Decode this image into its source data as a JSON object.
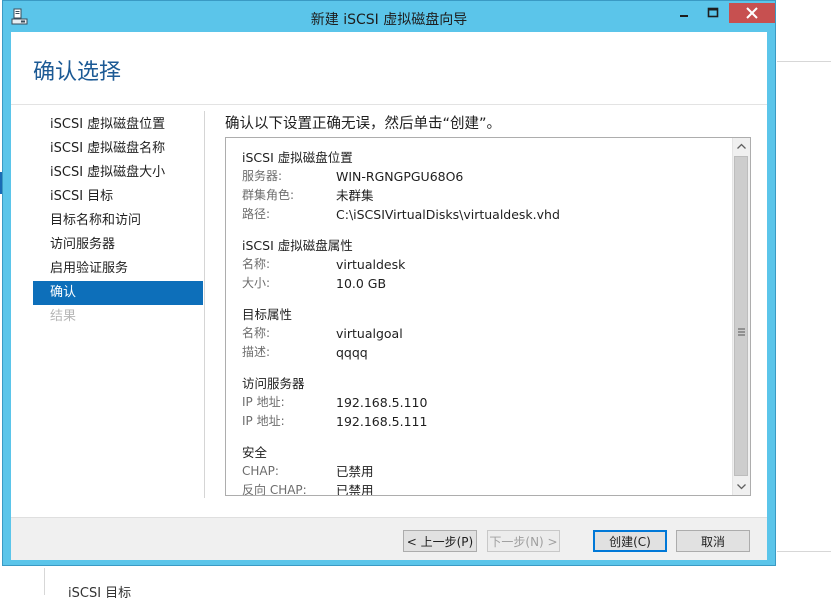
{
  "window": {
    "title": "新建 iSCSI 虚拟磁盘向导"
  },
  "page": {
    "heading": "确认选择",
    "main_title": "确认以下设置正确无误，然后单击“创建”。"
  },
  "nav": {
    "items": [
      {
        "label": "iSCSI 虚拟磁盘位置",
        "state": "normal"
      },
      {
        "label": "iSCSI 虚拟磁盘名称",
        "state": "normal"
      },
      {
        "label": "iSCSI 虚拟磁盘大小",
        "state": "normal"
      },
      {
        "label": "iSCSI 目标",
        "state": "normal"
      },
      {
        "label": "目标名称和访问",
        "state": "normal"
      },
      {
        "label": "访问服务器",
        "state": "normal"
      },
      {
        "label": "启用验证服务",
        "state": "normal"
      },
      {
        "label": "确认",
        "state": "active"
      },
      {
        "label": "结果",
        "state": "disabled"
      }
    ]
  },
  "summary": {
    "sections": [
      {
        "title": "iSCSI 虚拟磁盘位置",
        "rows": [
          {
            "label": "服务器:",
            "value": "WIN-RGNGPGU68O6"
          },
          {
            "label": "群集角色:",
            "value": "未群集"
          },
          {
            "label": "路径:",
            "value": "C:\\iSCSIVirtualDisks\\virtualdesk.vhd"
          }
        ]
      },
      {
        "title": "iSCSI 虚拟磁盘属性",
        "rows": [
          {
            "label": "名称:",
            "value": "virtualdesk"
          },
          {
            "label": "大小:",
            "value": "10.0 GB"
          }
        ]
      },
      {
        "title": "目标属性",
        "rows": [
          {
            "label": "名称:",
            "value": "virtualgoal"
          },
          {
            "label": "描述:",
            "value": "qqqq"
          }
        ]
      },
      {
        "title": "访问服务器",
        "rows": [
          {
            "label": "IP 地址:",
            "value": "192.168.5.110"
          },
          {
            "label": "IP 地址:",
            "value": "192.168.5.111"
          }
        ]
      },
      {
        "title": "安全",
        "rows": [
          {
            "label": "CHAP:",
            "value": "已禁用"
          },
          {
            "label": "反向 CHAP:",
            "value": "已禁用"
          }
        ]
      }
    ]
  },
  "footer": {
    "prev_label": "< 上一步(P)",
    "next_label": "下一步(N) >",
    "create_label": "创建(C)",
    "cancel_label": "取消"
  },
  "background": {
    "bottom_text": "iSCSI 目标"
  },
  "colors": {
    "titlebar": "#5bc5ea",
    "heading": "#1c5a95",
    "nav_active": "#0d6fba",
    "close_button": "#c75050"
  }
}
